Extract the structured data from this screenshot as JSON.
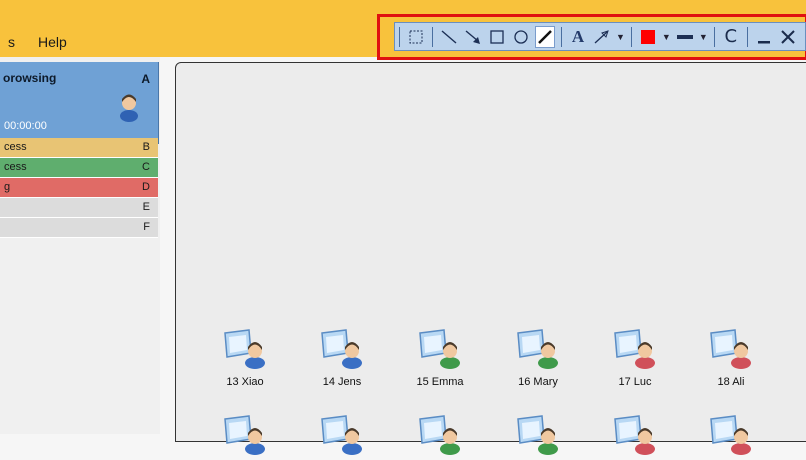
{
  "menu": {
    "items": [
      "s",
      "Help"
    ]
  },
  "toolbar": {
    "tools": [
      "select-rect",
      "line",
      "arrow",
      "rectangle",
      "ellipse",
      "pen",
      "text",
      "pointer",
      "color",
      "line-width",
      "clear",
      "minimize",
      "close"
    ],
    "text_tool_label": "A",
    "clear_label": "C",
    "color": "#ff0000"
  },
  "active_student": {
    "title": "orowsing",
    "key": "A",
    "time": "00:00:00"
  },
  "groups": [
    {
      "label": "cess",
      "key": "B",
      "color": "#e8c474"
    },
    {
      "label": "cess",
      "key": "C",
      "color": "#5fae6e"
    },
    {
      "label": "g",
      "key": "D",
      "color": "#e06b66"
    },
    {
      "label": "",
      "key": "E",
      "color": "#dcdcdc"
    },
    {
      "label": "",
      "key": "F",
      "color": "#dcdcdc"
    }
  ],
  "students": [
    {
      "name": "13 Xiao",
      "shirt": "#3a6fc4"
    },
    {
      "name": "14 Jens",
      "shirt": "#3a6fc4"
    },
    {
      "name": "15 Emma",
      "shirt": "#3f9a4a"
    },
    {
      "name": "16 Mary",
      "shirt": "#3f9a4a"
    },
    {
      "name": "17 Luc",
      "shirt": "#d0505a"
    },
    {
      "name": "18 Ali",
      "shirt": "#d0505a"
    }
  ]
}
